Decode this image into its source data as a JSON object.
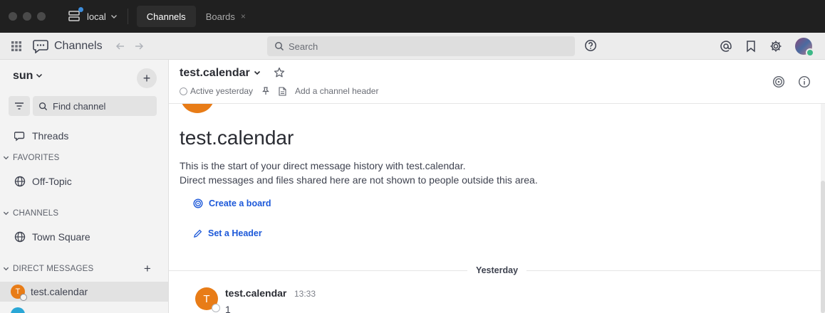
{
  "titlebar": {
    "server_name": "local",
    "tabs": [
      {
        "label": "Channels",
        "active": true
      },
      {
        "label": "Boards",
        "active": false,
        "close": "×"
      }
    ]
  },
  "header": {
    "product_name": "Channels",
    "search_placeholder": "Search"
  },
  "sidebar": {
    "team_name": "sun",
    "find_channel_label": "Find channel",
    "threads_label": "Threads",
    "categories": [
      {
        "label": "FAVORITES",
        "items": [
          {
            "label": "Off-Topic",
            "icon": "globe-icon"
          }
        ]
      },
      {
        "label": "CHANNELS",
        "items": [
          {
            "label": "Town Square",
            "icon": "globe-icon"
          }
        ]
      },
      {
        "label": "DIRECT MESSAGES",
        "items": [
          {
            "label": "test.calendar",
            "avatar_initial": "T",
            "active": true
          }
        ]
      }
    ]
  },
  "channel": {
    "name": "test.calendar",
    "status": "Active yesterday",
    "header_placeholder": "Add a channel header",
    "intro_title": "test.calendar",
    "intro_line1": "This is the start of your direct message history with test.calendar.",
    "intro_line2": "Direct messages and files shared here are not shown to people outside this area.",
    "actions": [
      {
        "label": "Create a board",
        "icon": "boards-icon"
      },
      {
        "label": "Set a Header",
        "icon": "pencil-icon"
      }
    ],
    "date_separator": "Yesterday",
    "posts": [
      {
        "author": "test.calendar",
        "initial": "T",
        "time": "13:33",
        "message": "1"
      }
    ]
  },
  "colors": {
    "accent": "#1c58d9",
    "avatar_orange": "#e87c17",
    "online_green": "#3db887"
  }
}
